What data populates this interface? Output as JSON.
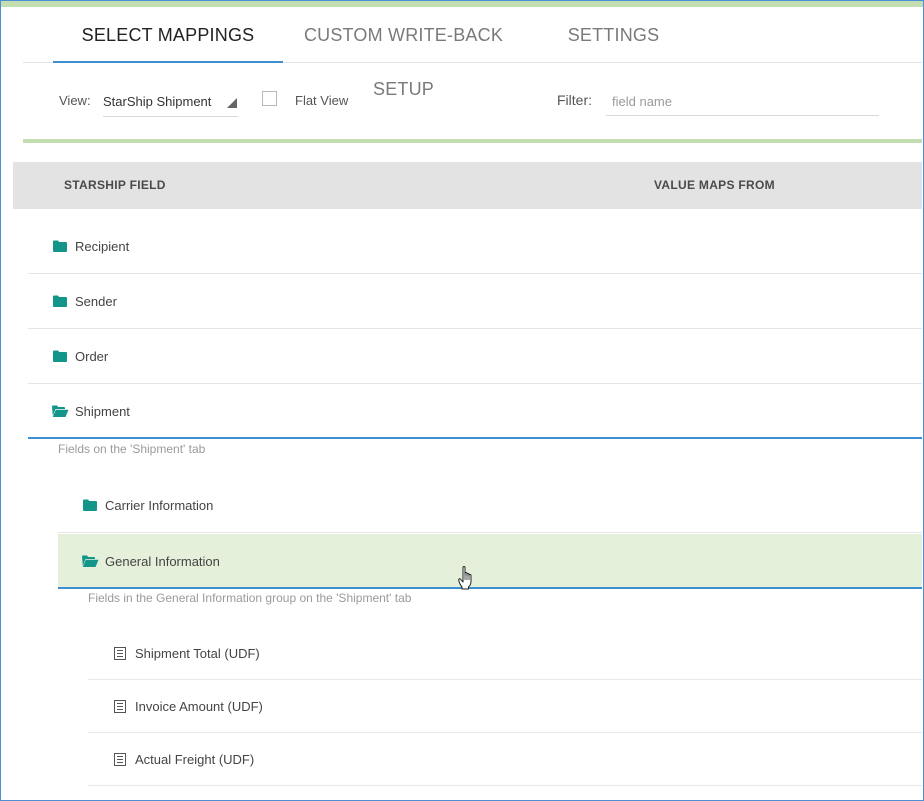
{
  "tabs": [
    {
      "label": "SELECT MAPPINGS",
      "active": true
    },
    {
      "label": "CUSTOM WRITE-BACK SETUP",
      "active": false
    },
    {
      "label": "SETTINGS",
      "active": false
    }
  ],
  "toolbar": {
    "view_label": "View:",
    "view_value": "StarShip Shipment",
    "flat_view_label": "Flat View",
    "flat_view_checked": false,
    "filter_label": "Filter:",
    "filter_placeholder": "field name",
    "filter_value": ""
  },
  "grid": {
    "columns": [
      "STARSHIP FIELD",
      "VALUE MAPS FROM"
    ],
    "groups": [
      {
        "label": "Recipient",
        "expanded": false,
        "icon": "folder-icon"
      },
      {
        "label": "Sender",
        "expanded": false,
        "icon": "folder-icon"
      },
      {
        "label": "Order",
        "expanded": false,
        "icon": "folder-icon"
      },
      {
        "label": "Shipment",
        "expanded": true,
        "icon": "folder-open-icon"
      }
    ],
    "shipment_description": "Fields on the 'Shipment' tab",
    "subgroups": [
      {
        "label": "Carrier Information",
        "expanded": false,
        "icon": "folder-icon"
      },
      {
        "label": "General Information",
        "expanded": true,
        "icon": "folder-open-icon"
      }
    ],
    "general_description": "Fields in the General Information group on the 'Shipment' tab",
    "fields": [
      {
        "label": "Shipment Total (UDF)",
        "icon": "field-list-icon"
      },
      {
        "label": "Invoice Amount (UDF)",
        "icon": "field-list-icon"
      },
      {
        "label": "Actual Freight (UDF)",
        "icon": "field-list-icon"
      }
    ]
  },
  "colors": {
    "accent_blue": "#3d8fd1",
    "accent_green": "#c5deb1",
    "folder_teal": "#14958a",
    "highlight_row": "#e5f0da"
  }
}
